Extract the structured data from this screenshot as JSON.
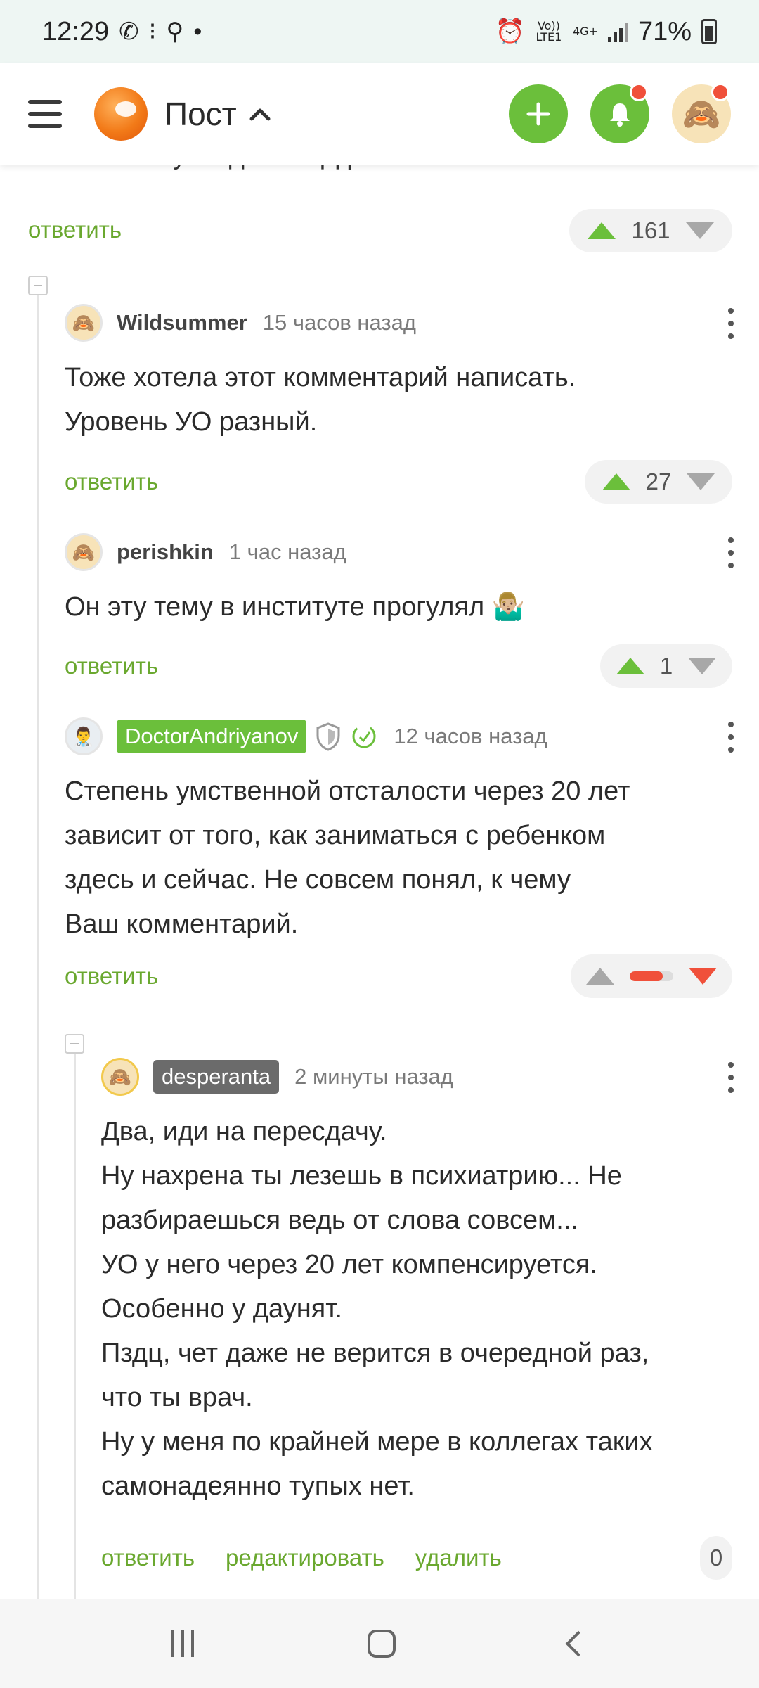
{
  "status_bar": {
    "time": "12:29",
    "battery": "71%",
    "volte": "Vo)) LTE1",
    "net": "4G+"
  },
  "header": {
    "title": "Пост",
    "logo": "pikabu-logo",
    "actions": [
      "add-post-icon",
      "notifications-icon",
      "profile-avatar"
    ]
  },
  "partial_comment": {
    "text_tail": "отсталости у людей с СД разная.",
    "reply_label": "ответить",
    "rating": "161"
  },
  "comments": [
    {
      "username": "Wildsummer",
      "time": "15 часов назад",
      "lines": [
        "Тоже хотела этот комментарий написать.",
        "Уровень УО разный."
      ],
      "reply_label": "ответить",
      "rating": "27"
    },
    {
      "username": "perishkin",
      "time": "1 час назад",
      "lines": [
        "Он эту тему в институте прогулял 🤷🏼‍♂️"
      ],
      "reply_label": "ответить",
      "rating": "1"
    },
    {
      "username": "DoctorAndriyanov",
      "time": "12 часов назад",
      "lines": [
        "Степень умственной отсталости через 20 лет",
        "зависит от того, как заниматься с ребенком",
        "здесь и сейчас. Не совсем понял, к чему",
        "Ваш комментарий."
      ],
      "reply_label": "ответить",
      "rating_hidden_fraction": 0.75
    },
    {
      "username": "desperanta",
      "time": "2 минуты назад",
      "lines": [
        "Два, иди на пересдачу.",
        "Ну нахрена ты лезешь в психиатрию... Не",
        "разбираешься ведь от слова совсем...",
        "УО у него через 20 лет компенсируется.",
        "Особенно у даунят.",
        "Пздц, чет даже не верится в очередной раз,",
        "что ты врач.",
        "Ну у меня по крайней мере в коллегах таких",
        "самонадеянно тупых нет."
      ],
      "reply_label": "ответить",
      "edit_label": "редактировать",
      "delete_label": "удалить",
      "rating": "0"
    }
  ],
  "colors": {
    "accent_green": "#6bbf3b",
    "link_green": "#6aa82f",
    "alert_red": "#f0503a"
  }
}
